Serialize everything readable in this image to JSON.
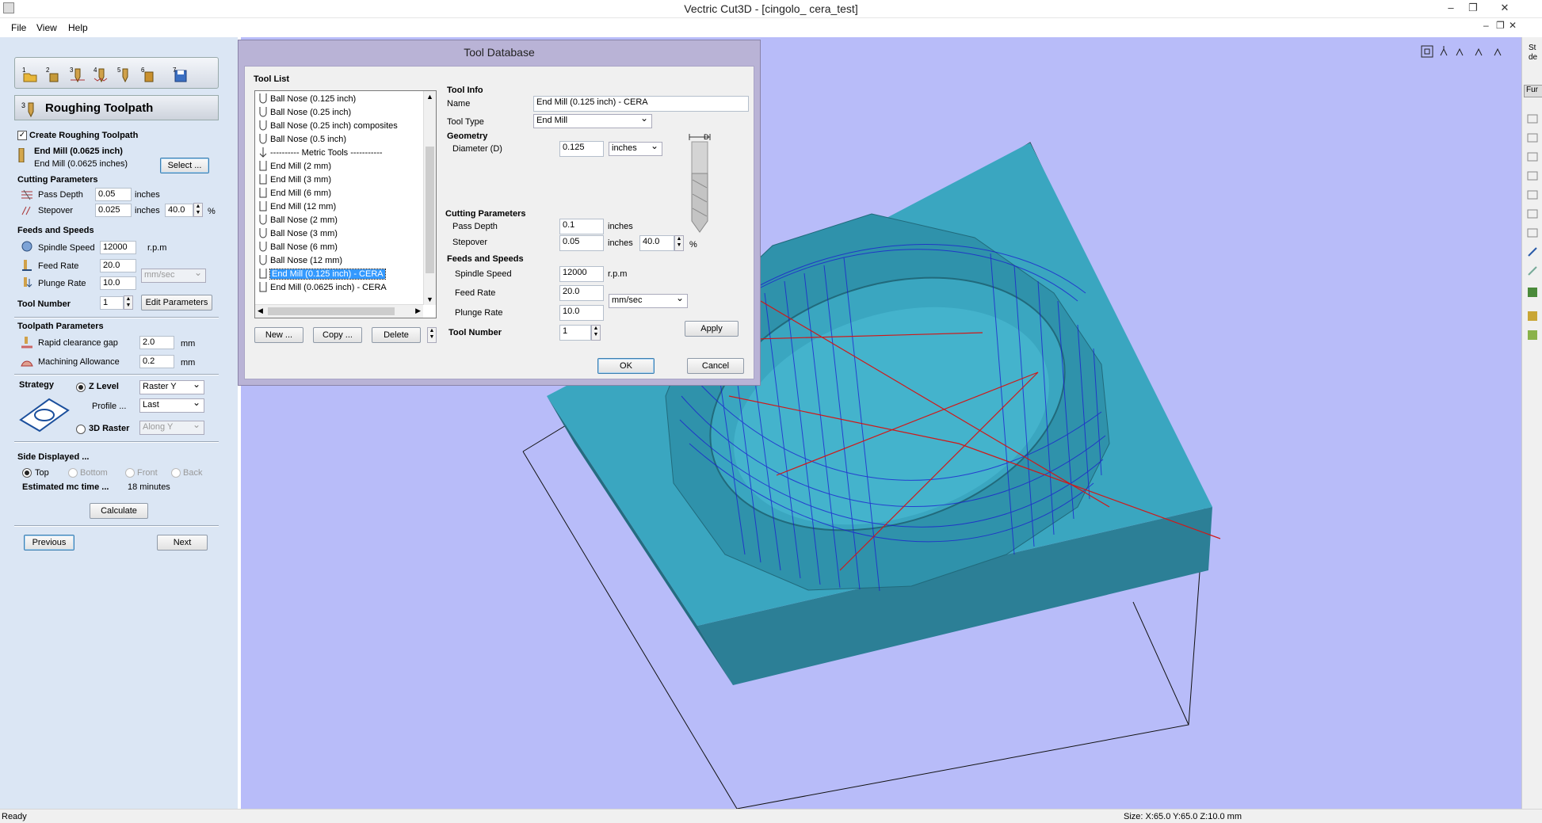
{
  "window": {
    "title": "Vectric Cut3D - [cingolo_ cera_test]",
    "minimize": "–",
    "restore": "❐",
    "close": "✕"
  },
  "menu": {
    "items": [
      "File",
      "View",
      "Help"
    ]
  },
  "left_panel": {
    "toolbar_steps": [
      "1",
      "2",
      "3",
      "4",
      "5",
      "6",
      "7"
    ],
    "panel_title": "Roughing Toolpath",
    "create_roughing_label": "Create Roughing Toolpath",
    "create_roughing_checked": true,
    "tool_name": "End Mill (0.0625 inch)",
    "tool_sub": "End Mill (0.0625 inches)",
    "select_button": "Select ...",
    "cutting_parameters_heading": "Cutting Parameters",
    "pass_depth_label": "Pass Depth",
    "pass_depth_value": "0.05",
    "pass_depth_unit": "inches",
    "stepover_label": "Stepover",
    "stepover_value": "0.025",
    "stepover_unit": "inches",
    "stepover_percent": "40.0",
    "percent_sign": "%",
    "feeds_heading": "Feeds and Speeds",
    "spindle_label": "Spindle Speed",
    "spindle_value": "12000",
    "spindle_unit": "r.p.m",
    "feed_label": "Feed Rate",
    "feed_value": "20.0",
    "feed_unit_select": "mm/sec",
    "plunge_label": "Plunge Rate",
    "plunge_value": "10.0",
    "tool_number_label": "Tool Number",
    "tool_number_value": "1",
    "edit_parameters_button": "Edit Parameters",
    "toolpath_params_heading": "Toolpath Parameters",
    "rapid_label": "Rapid clearance gap",
    "rapid_value": "2.0",
    "rapid_unit": "mm",
    "allowance_label": "Machining Allowance",
    "allowance_value": "0.2",
    "allowance_unit": "mm",
    "strategy_label": "Strategy",
    "zlevel_label": "Z Level",
    "zlevel_select": "Raster Y",
    "profile_label": "Profile ...",
    "profile_select": "Last",
    "raster3d_label": "3D Raster",
    "raster3d_select": "Along Y",
    "side_heading": "Side Displayed ...",
    "side_options": [
      "Top",
      "Bottom",
      "Front",
      "Back"
    ],
    "est_label": "Estimated mc time ...",
    "est_value": "18 minutes",
    "calculate_button": "Calculate",
    "previous_button": "Previous",
    "next_button": "Next"
  },
  "dialog": {
    "title": "Tool Database",
    "tool_list_heading": "Tool List",
    "tools": [
      "Ball Nose (0.125 inch)",
      "Ball Nose (0.25 inch)",
      "Ball Nose (0.25 inch) composites",
      "Ball Nose (0.5 inch)",
      "---------- Metric Tools -----------",
      "End Mill (2 mm)",
      "End Mill (3 mm)",
      "End Mill (6 mm)",
      "End Mill (12 mm)",
      "Ball Nose (2 mm)",
      "Ball Nose (3 mm)",
      "Ball Nose (6 mm)",
      "Ball Nose (12 mm)",
      "End Mill (0.125 inch) - CERA",
      "End Mill (0.0625 inch) - CERA"
    ],
    "selected_tool": "End Mill (0.125 inch) - CERA",
    "new_button": "New ...",
    "copy_button": "Copy ...",
    "delete_button": "Delete",
    "tool_info_heading": "Tool Info",
    "name_label": "Name",
    "name_value": "End Mill (0.125 inch) - CERA",
    "tool_type_label": "Tool Type",
    "tool_type_value": "End Mill",
    "geometry_heading": "Geometry",
    "diameter_label": "Diameter (D)",
    "diameter_value": "0.125",
    "diameter_unit": "inches",
    "diagram_label": "D",
    "cutting_heading": "Cutting Parameters",
    "pass_depth_label": "Pass Depth",
    "pass_depth_value": "0.1",
    "pass_depth_unit": "inches",
    "stepover_label": "Stepover",
    "stepover_value": "0.05",
    "stepover_unit": "inches",
    "stepover_percent": "40.0",
    "percent_sign": "%",
    "feeds_heading": "Feeds and Speeds",
    "spindle_label": "Spindle Speed",
    "spindle_value": "12000",
    "spindle_unit": "r.p.m",
    "feed_label": "Feed Rate",
    "feed_value": "20.0",
    "rate_unit": "mm/sec",
    "plunge_label": "Plunge Rate",
    "plunge_value": "10.0",
    "tool_number_label": "Tool Number",
    "tool_number_value": "1",
    "apply_button": "Apply",
    "ok_button": "OK",
    "cancel_button": "Cancel"
  },
  "right_strip": {
    "cut_text_1": "St",
    "cut_text_2": "de",
    "tab_label": "Fur"
  },
  "status": {
    "left": "Ready",
    "right": "Size: X:65.0 Y:65.0 Z:10.0 mm"
  },
  "colors": {
    "panel_bg": "#dbe6f4",
    "viewport_bg": "#b8bcf9",
    "block_top": "#3aa6c0",
    "block_side": "#2c7f96",
    "toolpath_blue": "#1a1ad0",
    "toolpath_red": "#d01818",
    "dialog_frame": "#b9b3d6",
    "selection": "#3399ff"
  },
  "icons": [
    "open-file-icon",
    "tool-icon",
    "roughing-icon",
    "finishing-icon",
    "cutout-icon",
    "preview-icon",
    "save-toolpath-icon",
    "zoom-all-icon",
    "view-iso-icon",
    "view-z-icon",
    "view-x-icon",
    "view-y-icon"
  ]
}
